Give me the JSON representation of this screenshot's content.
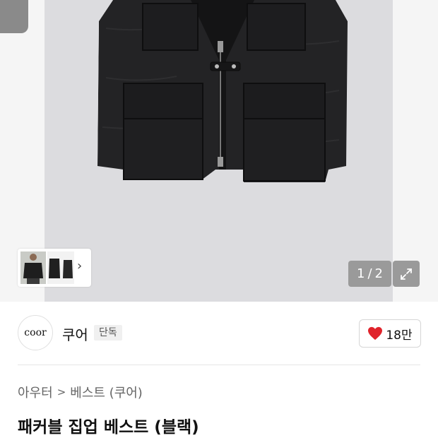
{
  "gallery": {
    "page_current": "1",
    "page_separator": "/",
    "page_total": "2",
    "expand_icon": "expand-icon",
    "thumb_arrow_icon": "chevron-right-icon"
  },
  "brand": {
    "logo_text": "coor",
    "name": "쿠어",
    "badge": "단독",
    "like_icon": "heart-icon",
    "like_count": "18만",
    "like_color": "#e0232b"
  },
  "breadcrumb": {
    "category": "아우터",
    "separator": ">",
    "subcategory": "베스트 (쿠어)"
  },
  "product": {
    "title": "패커블 집업 베스트 (블랙)"
  }
}
